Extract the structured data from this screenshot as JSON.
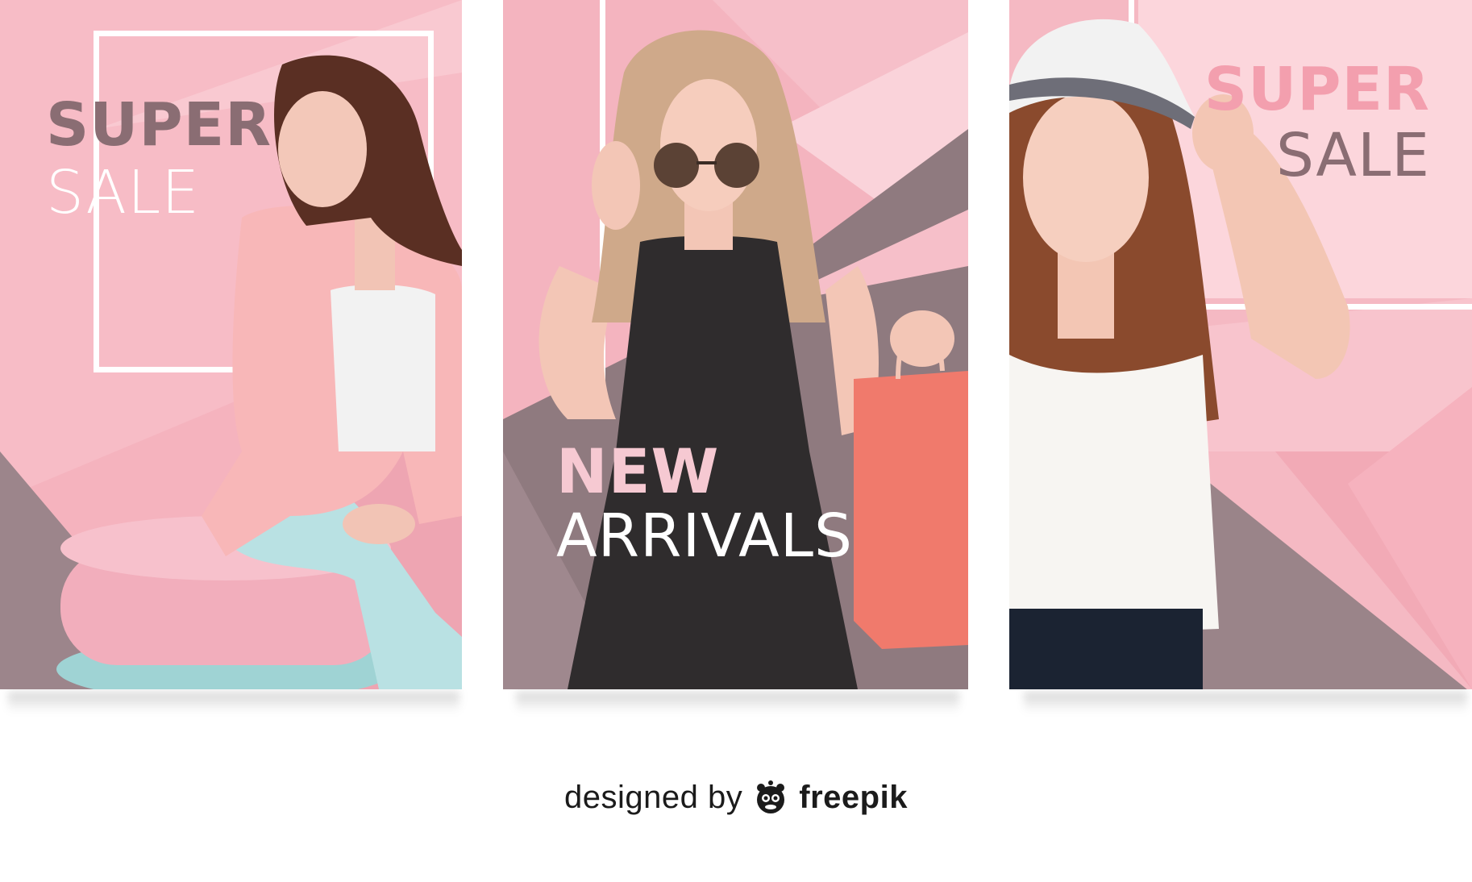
{
  "cards": [
    {
      "id": "card-1",
      "headline_bold": "SUPER",
      "headline_light": "SALE",
      "palette": {
        "pink": "#f5b3be",
        "light_pink": "#f9c9d1",
        "mauve": "#9c858b",
        "blush": "#eea5b2"
      }
    },
    {
      "id": "card-2",
      "headline_bold": "NEW",
      "headline_light": "ARRIVALS",
      "palette": {
        "pink": "#f4b4bf",
        "light_pink": "#fad3da",
        "mauve": "#8f7a7f",
        "blush": "#e796a5"
      }
    },
    {
      "id": "card-3",
      "headline_bold": "SUPER",
      "headline_light": "SALE",
      "palette": {
        "pink": "#f5b9c3",
        "light_pink": "#fcd6dc",
        "mauve": "#9a8489",
        "blush": "#f2aab6"
      }
    }
  ],
  "credit": {
    "designed_by": "designed by",
    "brand": "freepik",
    "logo_icon": "freepik-bear-icon"
  }
}
